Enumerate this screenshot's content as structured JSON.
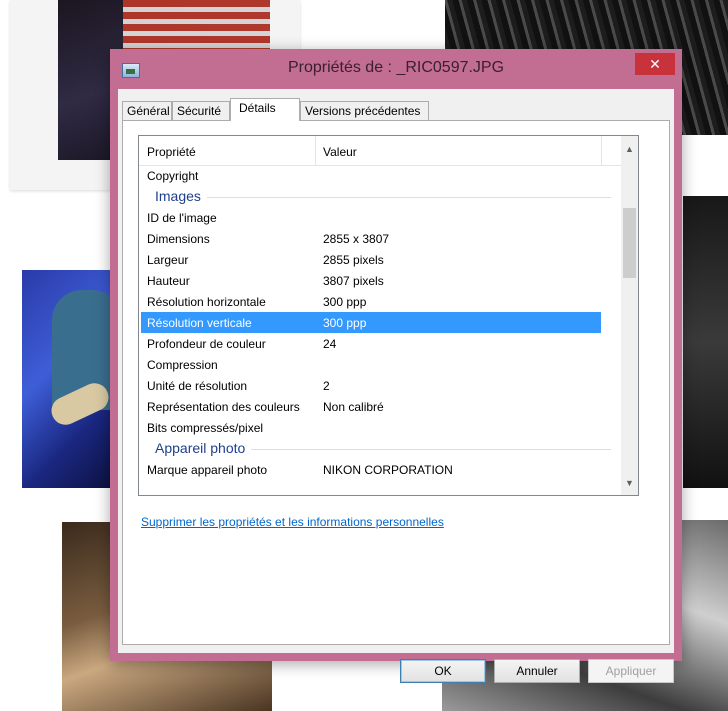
{
  "window": {
    "title": "Propriétés de : _RIC0597.JPG",
    "close_glyph": "✕"
  },
  "tabs": [
    {
      "label": "Général"
    },
    {
      "label": "Sécurité"
    },
    {
      "label": "Détails"
    },
    {
      "label": "Versions précédentes"
    }
  ],
  "active_tab": "Détails",
  "table": {
    "col_property": "Propriété",
    "col_value": "Valeur",
    "rows": [
      {
        "k": "Copyright",
        "v": ""
      },
      {
        "group": "Images"
      },
      {
        "k": "ID de l'image",
        "v": ""
      },
      {
        "k": "Dimensions",
        "v": "2855 x 3807"
      },
      {
        "k": "Largeur",
        "v": "2855 pixels"
      },
      {
        "k": "Hauteur",
        "v": "3807 pixels"
      },
      {
        "k": "Résolution horizontale",
        "v": "300 ppp"
      },
      {
        "k": "Résolution verticale",
        "v": "300 ppp"
      },
      {
        "k": "Profondeur de couleur",
        "v": "24"
      },
      {
        "k": "Compression",
        "v": ""
      },
      {
        "k": "Unité de résolution",
        "v": "2"
      },
      {
        "k": "Représentation des couleurs",
        "v": "Non calibré"
      },
      {
        "k": "Bits compressés/pixel",
        "v": ""
      },
      {
        "group": "Appareil photo"
      },
      {
        "k": "Marque appareil photo",
        "v": "NIKON CORPORATION"
      }
    ],
    "selected_row": "Résolution verticale"
  },
  "link": "Supprimer les propriétés et les informations personnelles",
  "buttons": {
    "ok": "OK",
    "cancel": "Annuler",
    "apply": "Appliquer"
  },
  "colors": {
    "frame": "#c26d92",
    "selection": "#3399ff",
    "close": "#c8323a"
  }
}
